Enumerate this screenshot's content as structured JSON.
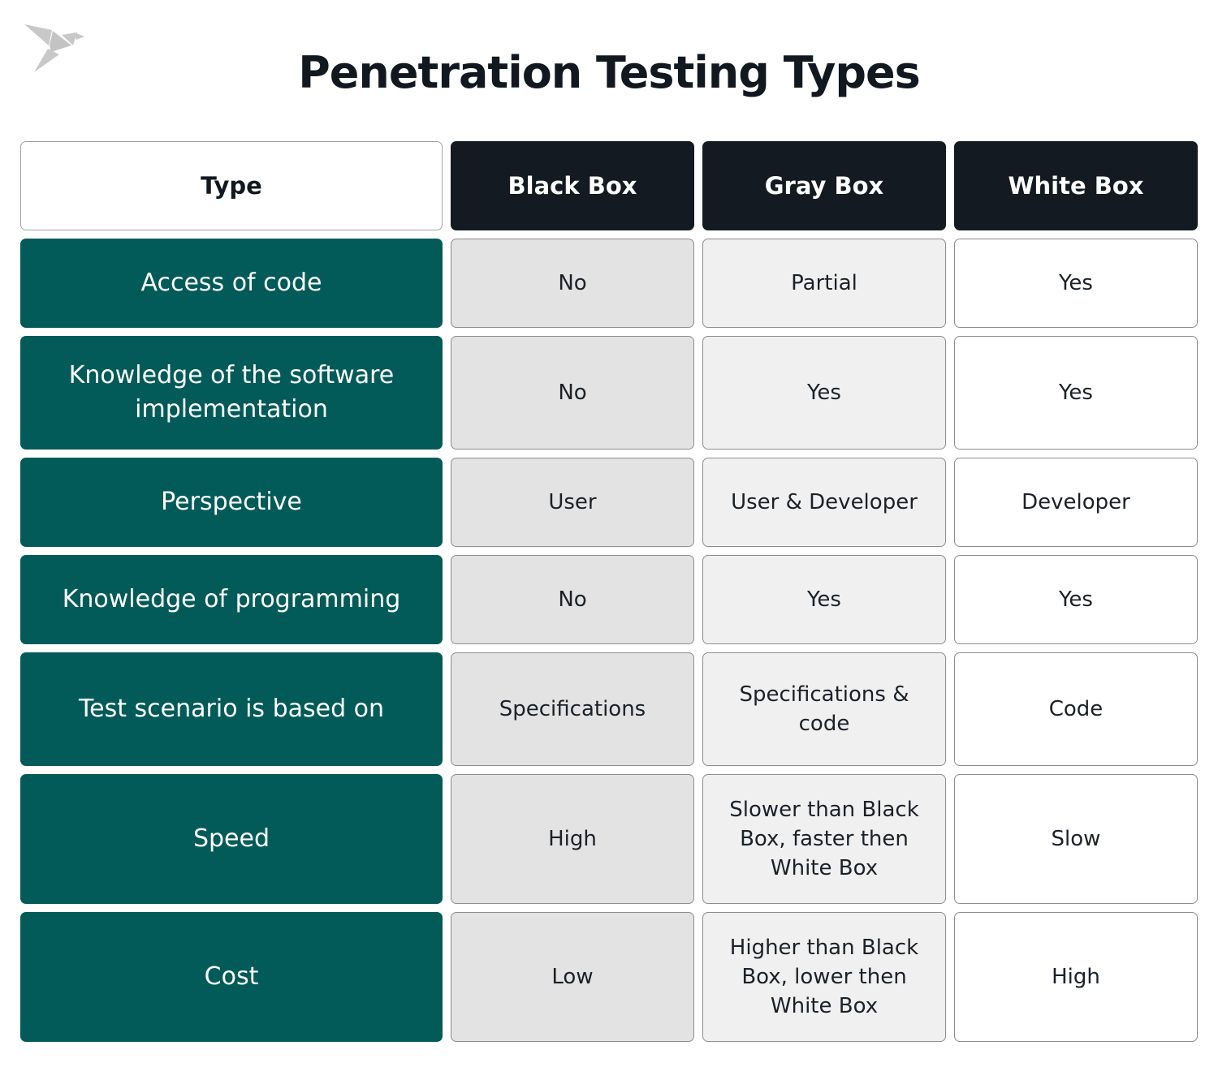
{
  "title": "Penetration Testing Types",
  "logo": {
    "icon": "origami-bird-icon",
    "color": "#c8c8c8"
  },
  "colors": {
    "header_dark": "#131a21",
    "row_label": "#025b59",
    "black_box_cell": "#e3e3e3",
    "gray_box_cell": "#f0f0f0",
    "white_box_cell": "#ffffff"
  },
  "table": {
    "headers": [
      "Type",
      "Black Box",
      "Gray Box",
      "White Box"
    ],
    "rows": [
      {
        "label": "Access of code",
        "black": "No",
        "gray": "Partial",
        "white": "Yes"
      },
      {
        "label": "Knowledge of the software implementation",
        "black": "No",
        "gray": "Yes",
        "white": "Yes"
      },
      {
        "label": "Perspective",
        "black": "User",
        "gray": "User & Developer",
        "white": "Developer"
      },
      {
        "label": "Knowledge of programming",
        "black": "No",
        "gray": "Yes",
        "white": "Yes"
      },
      {
        "label": "Test scenario is based on",
        "black": "Specifications",
        "gray": "Specifications & code",
        "white": "Code"
      },
      {
        "label": "Speed",
        "black": "High",
        "gray": "Slower than Black Box, faster then White Box",
        "white": "Slow"
      },
      {
        "label": "Cost",
        "black": "Low",
        "gray": "Higher than Black Box, lower then White Box",
        "white": "High"
      }
    ]
  }
}
